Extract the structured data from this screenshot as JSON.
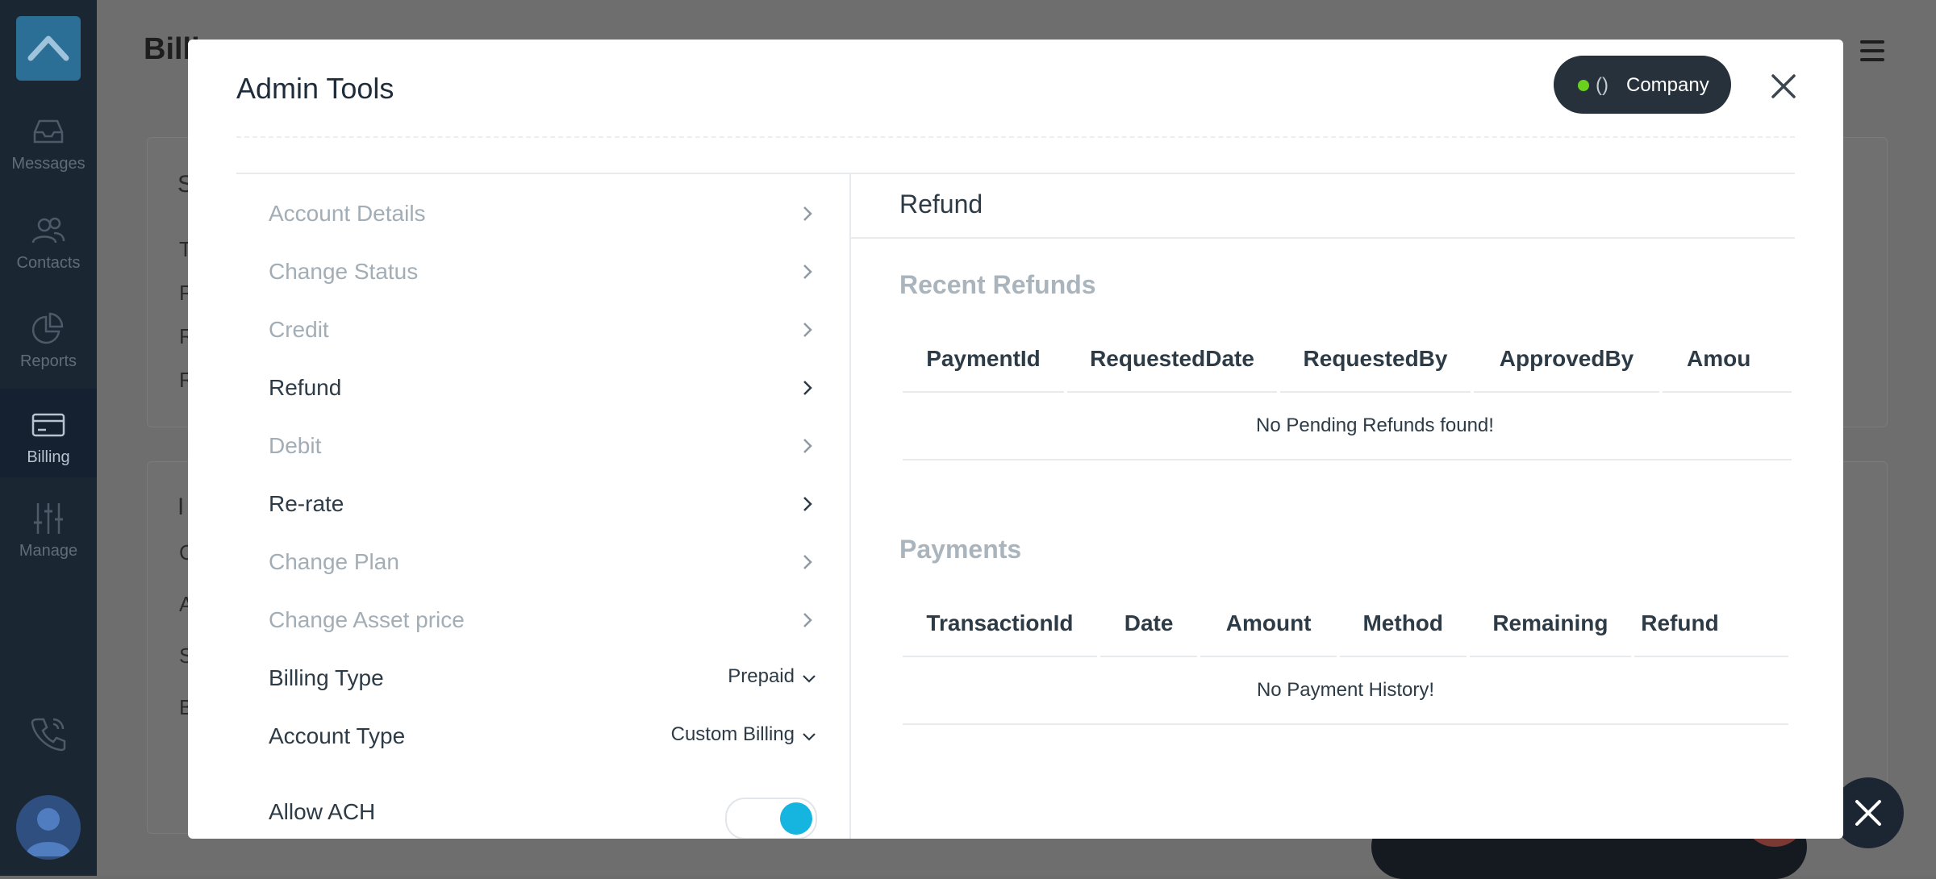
{
  "app": {
    "header_title": "Billi",
    "nav": [
      {
        "label": "Messages",
        "icon": "inbox-icon"
      },
      {
        "label": "Contacts",
        "icon": "contacts-icon"
      },
      {
        "label": "Reports",
        "icon": "pie-chart-icon"
      },
      {
        "label": "Billing",
        "icon": "credit-card-icon"
      },
      {
        "label": "Manage",
        "icon": "sliders-icon"
      }
    ],
    "bg_letters": [
      "S",
      "T",
      "P",
      "R",
      "R",
      "I",
      "C",
      "A",
      "S",
      "B"
    ]
  },
  "modal": {
    "title": "Admin Tools",
    "company_badge": {
      "paren": "()",
      "label": "Company",
      "status_color": "#6bd11f"
    },
    "menu": [
      {
        "label": "Account Details",
        "active": false
      },
      {
        "label": "Change Status",
        "active": false
      },
      {
        "label": "Credit",
        "active": false
      },
      {
        "label": "Refund",
        "active": true
      },
      {
        "label": "Debit",
        "active": false
      },
      {
        "label": "Re-rate",
        "active": false
      },
      {
        "label": "Change Plan",
        "active": false
      },
      {
        "label": "Change Asset price",
        "active": false
      }
    ],
    "settings": {
      "billing_type": {
        "label": "Billing Type",
        "value": "Prepaid"
      },
      "account_type": {
        "label": "Account Type",
        "value": "Custom Billing"
      },
      "allow_ach": {
        "label": "Allow ACH",
        "enabled": true
      }
    },
    "panel": {
      "title": "Refund",
      "recent_refunds": {
        "title": "Recent Refunds",
        "columns": [
          "PaymentId",
          "RequestedDate",
          "RequestedBy",
          "ApprovedBy",
          "Amou"
        ],
        "empty_text": "No Pending Refunds found!"
      },
      "payments": {
        "title": "Payments",
        "columns": [
          "TransactionId",
          "Date",
          "Amount",
          "Method",
          "Remaining",
          "Refund"
        ],
        "empty_text": "No Payment History!"
      }
    }
  },
  "colors": {
    "accent": "#15b5e0",
    "dark": "#27313b",
    "muted": "#a2adb6"
  }
}
